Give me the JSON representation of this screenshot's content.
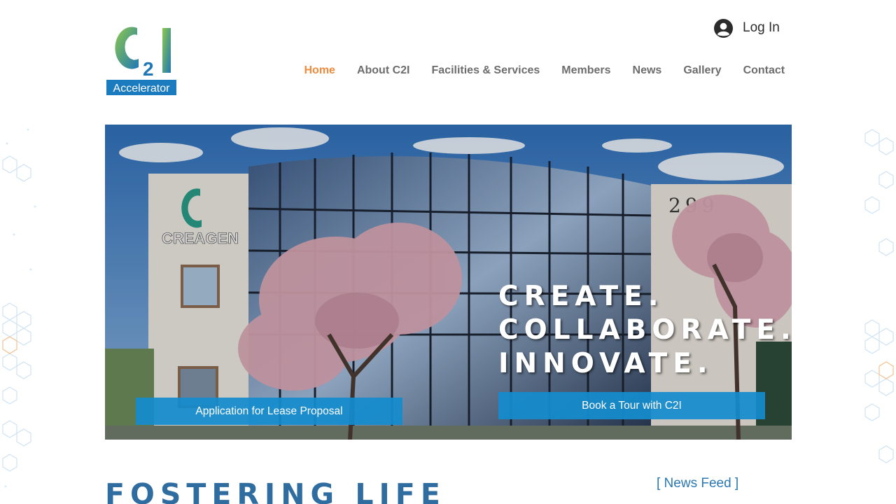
{
  "brand": {
    "logo_c": "C",
    "logo_2": "2",
    "logo_i": "I",
    "logo_tag": "Accelerator",
    "accent_color": "#f08a3c",
    "primary_blue": "#2f6da1"
  },
  "header": {
    "login_label": "Log In",
    "login_icon": "user-avatar-icon"
  },
  "nav": {
    "items": [
      {
        "label": "Home",
        "active": true
      },
      {
        "label": "About C2I"
      },
      {
        "label": "Facilities & Services"
      },
      {
        "label": "Members"
      },
      {
        "label": "News"
      },
      {
        "label": "Gallery"
      },
      {
        "label": "Contact"
      }
    ]
  },
  "hero": {
    "building_sign": "CREAGEN",
    "building_number": "299",
    "tagline": [
      "CREATE.",
      "COLLABORATE.",
      "INNOVATE."
    ],
    "lease_button": "Application for Lease Proposal",
    "tour_button": "Book a Tour with C2I",
    "button_color": "#148ccd"
  },
  "main": {
    "headline": "FOSTERING LIFE",
    "news_feed_label": "[ News Feed ]"
  }
}
